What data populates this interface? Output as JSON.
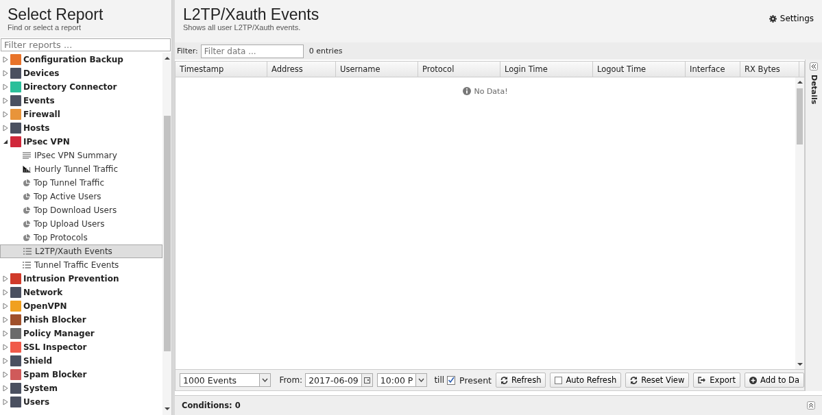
{
  "sidebar": {
    "title": "Select Report",
    "subtitle": "Find or select a report",
    "filter": {
      "placeholder": "Filter reports ..."
    },
    "tree": [
      {
        "label": "Configuration Backup",
        "color": "#e8732a",
        "expanded": false
      },
      {
        "label": "Devices",
        "color": "#4a5060",
        "expanded": false
      },
      {
        "label": "Directory Connector",
        "color": "#2bbf9a",
        "expanded": false
      },
      {
        "label": "Events",
        "color": "#4a5060",
        "expanded": false
      },
      {
        "label": "Firewall",
        "color": "#e8943a",
        "expanded": false
      },
      {
        "label": "Hosts",
        "color": "#4a5060",
        "expanded": false
      },
      {
        "label": "IPsec VPN",
        "color": "#d0283a",
        "expanded": true,
        "children": [
          {
            "label": "IPsec VPN Summary",
            "kind": "text",
            "selected": false
          },
          {
            "label": "Hourly Tunnel Traffic",
            "kind": "bar",
            "selected": false
          },
          {
            "label": "Top Tunnel Traffic",
            "kind": "pie",
            "selected": false
          },
          {
            "label": "Top Active Users",
            "kind": "pie",
            "selected": false
          },
          {
            "label": "Top Download Users",
            "kind": "pie",
            "selected": false
          },
          {
            "label": "Top Upload Users",
            "kind": "pie",
            "selected": false
          },
          {
            "label": "Top Protocols",
            "kind": "pie",
            "selected": false
          },
          {
            "label": "L2TP/Xauth Events",
            "kind": "list",
            "selected": true
          },
          {
            "label": "Tunnel Traffic Events",
            "kind": "list",
            "selected": false
          }
        ]
      },
      {
        "label": "Intrusion Prevention",
        "color": "#d03a2a",
        "expanded": false
      },
      {
        "label": "Network",
        "color": "#4a5060",
        "expanded": false
      },
      {
        "label": "OpenVPN",
        "color": "#f0a020",
        "expanded": false
      },
      {
        "label": "Phish Blocker",
        "color": "#a0502a",
        "expanded": false
      },
      {
        "label": "Policy Manager",
        "color": "#6a6a6a",
        "expanded": false
      },
      {
        "label": "SSL Inspector",
        "color": "#f05a4a",
        "expanded": false
      },
      {
        "label": "Shield",
        "color": "#4a5060",
        "expanded": false
      },
      {
        "label": "Spam Blocker",
        "color": "#d05a5a",
        "expanded": false
      },
      {
        "label": "System",
        "color": "#4a5060",
        "expanded": false
      },
      {
        "label": "Users",
        "color": "#4a5060",
        "expanded": false
      }
    ]
  },
  "report": {
    "title": "L2TP/Xauth Events",
    "subtitle": "Shows all user L2TP/Xauth events.",
    "settings": "Settings",
    "filter": {
      "label": "Filter:",
      "placeholder": "Filter data ...",
      "count": "0 entries"
    },
    "table": {
      "columns": [
        "Timestamp",
        "Address",
        "Username",
        "Protocol",
        "Login Time",
        "Logout Time",
        "Interface",
        "RX Bytes"
      ],
      "empty": "No Data!"
    },
    "details": "Details",
    "toolbar": {
      "limit": "1000 Events",
      "from_label": "From:",
      "date": "2017-06-09",
      "time": "10:00 P",
      "till": "till",
      "present": {
        "label": "Present",
        "checked": true
      },
      "buttons": [
        {
          "label": "Refresh",
          "kind": "refresh"
        },
        {
          "label": "Auto Refresh",
          "kind": "checkbox"
        },
        {
          "label": "Reset View",
          "kind": "refresh"
        },
        {
          "label": "Export",
          "kind": "export"
        },
        {
          "label": "Add to Da",
          "kind": "add"
        }
      ]
    },
    "conditions": "Conditions: 0"
  }
}
